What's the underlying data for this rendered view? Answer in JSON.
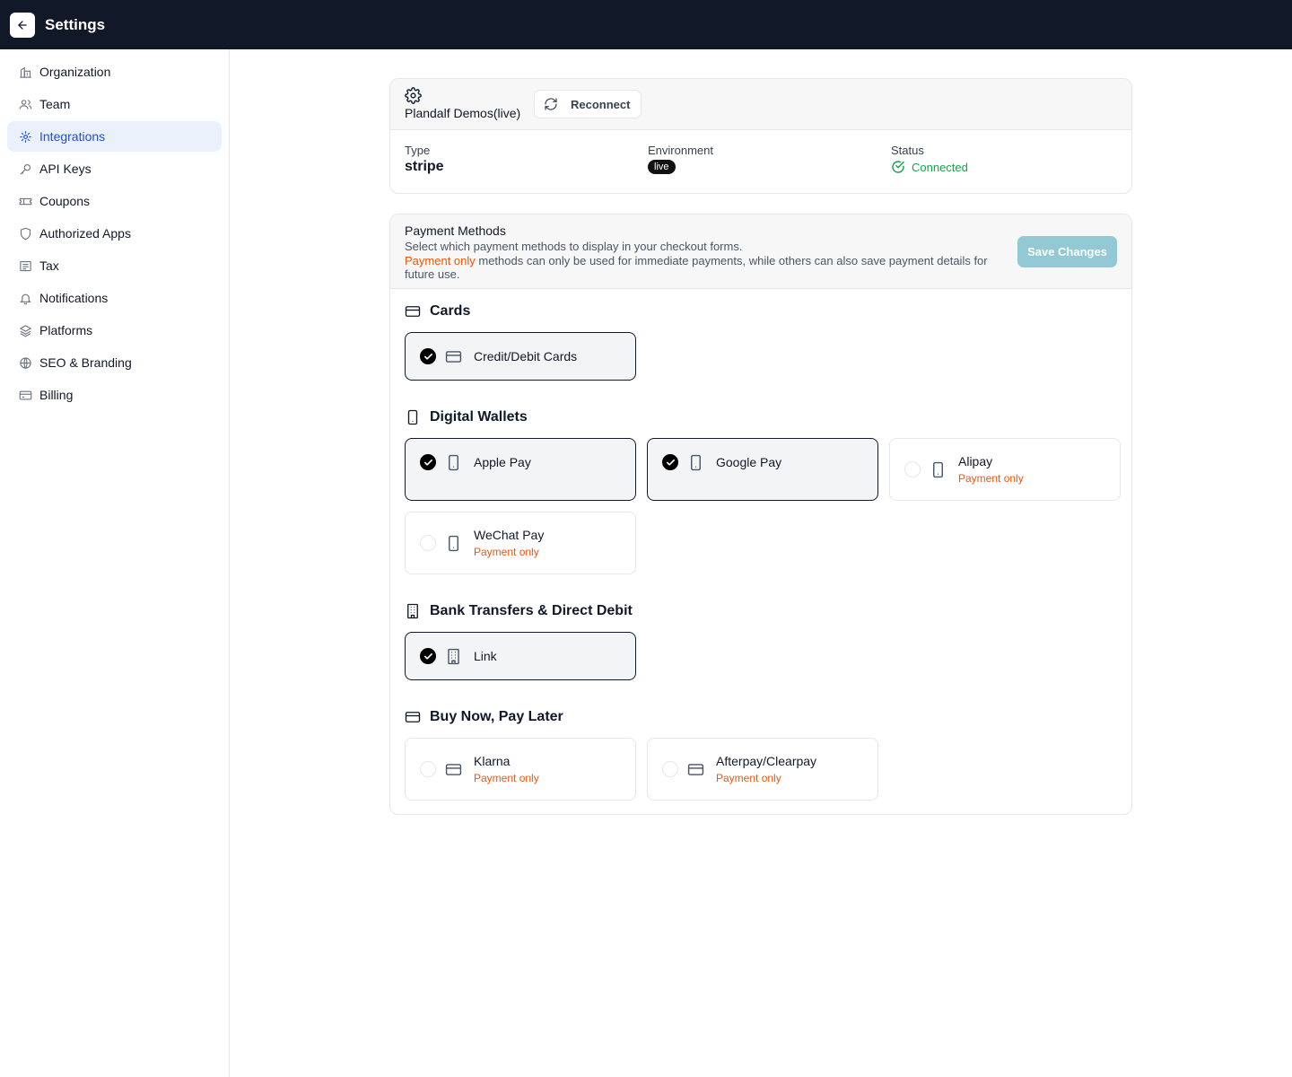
{
  "header": {
    "title": "Settings"
  },
  "sidebar": {
    "items": [
      {
        "label": "Organization",
        "icon": "building-icon",
        "active": false
      },
      {
        "label": "Team",
        "icon": "users-icon",
        "active": false
      },
      {
        "label": "Integrations",
        "icon": "plug-icon",
        "active": true
      },
      {
        "label": "API Keys",
        "icon": "key-icon",
        "active": false
      },
      {
        "label": "Coupons",
        "icon": "ticket-icon",
        "active": false
      },
      {
        "label": "Authorized Apps",
        "icon": "shield-icon",
        "active": false
      },
      {
        "label": "Tax",
        "icon": "receipt-icon",
        "active": false
      },
      {
        "label": "Notifications",
        "icon": "bell-icon",
        "active": false
      },
      {
        "label": "Platforms",
        "icon": "layers-icon",
        "active": false
      },
      {
        "label": "SEO & Branding",
        "icon": "globe-icon",
        "active": false
      },
      {
        "label": "Billing",
        "icon": "credit-card-icon",
        "active": false
      }
    ]
  },
  "connection": {
    "name": "Plandalf Demos(live)",
    "reconnect_label": "Reconnect",
    "type_label": "Type",
    "type_value": "stripe",
    "environment_label": "Environment",
    "environment_value": "live",
    "status_label": "Status",
    "status_value": "Connected"
  },
  "payment_methods": {
    "title": "Payment Methods",
    "description": "Select which payment methods to display in your checkout forms.",
    "highlight": "Payment only",
    "description2": " methods can only be used for immediate payments, while others can also save payment details for future use.",
    "save_label": "Save Changes",
    "sections": [
      {
        "title": "Cards",
        "options": [
          {
            "label": "Credit/Debit Cards",
            "checked": true
          }
        ]
      },
      {
        "title": "Digital Wallets",
        "options": [
          {
            "label": "Apple Pay",
            "checked": true
          },
          {
            "label": "Google Pay",
            "checked": true
          },
          {
            "label": "Alipay",
            "checked": false,
            "note": "Payment only"
          },
          {
            "label": "WeChat Pay",
            "checked": false,
            "note": "Payment only"
          }
        ]
      },
      {
        "title": "Bank Transfers & Direct Debit",
        "options": [
          {
            "label": "Link",
            "checked": true
          }
        ]
      },
      {
        "title": "Buy Now, Pay Later",
        "options": [
          {
            "label": "Klarna",
            "checked": false,
            "note": "Payment only"
          },
          {
            "label": "Afterpay/Clearpay",
            "checked": false,
            "note": "Payment only"
          }
        ]
      }
    ]
  },
  "colors": {
    "topbar": "#111827",
    "accent": "#2150c8",
    "success": "#16a34a",
    "payment_only": "#ea580c",
    "save_button": "#93c9d4"
  }
}
